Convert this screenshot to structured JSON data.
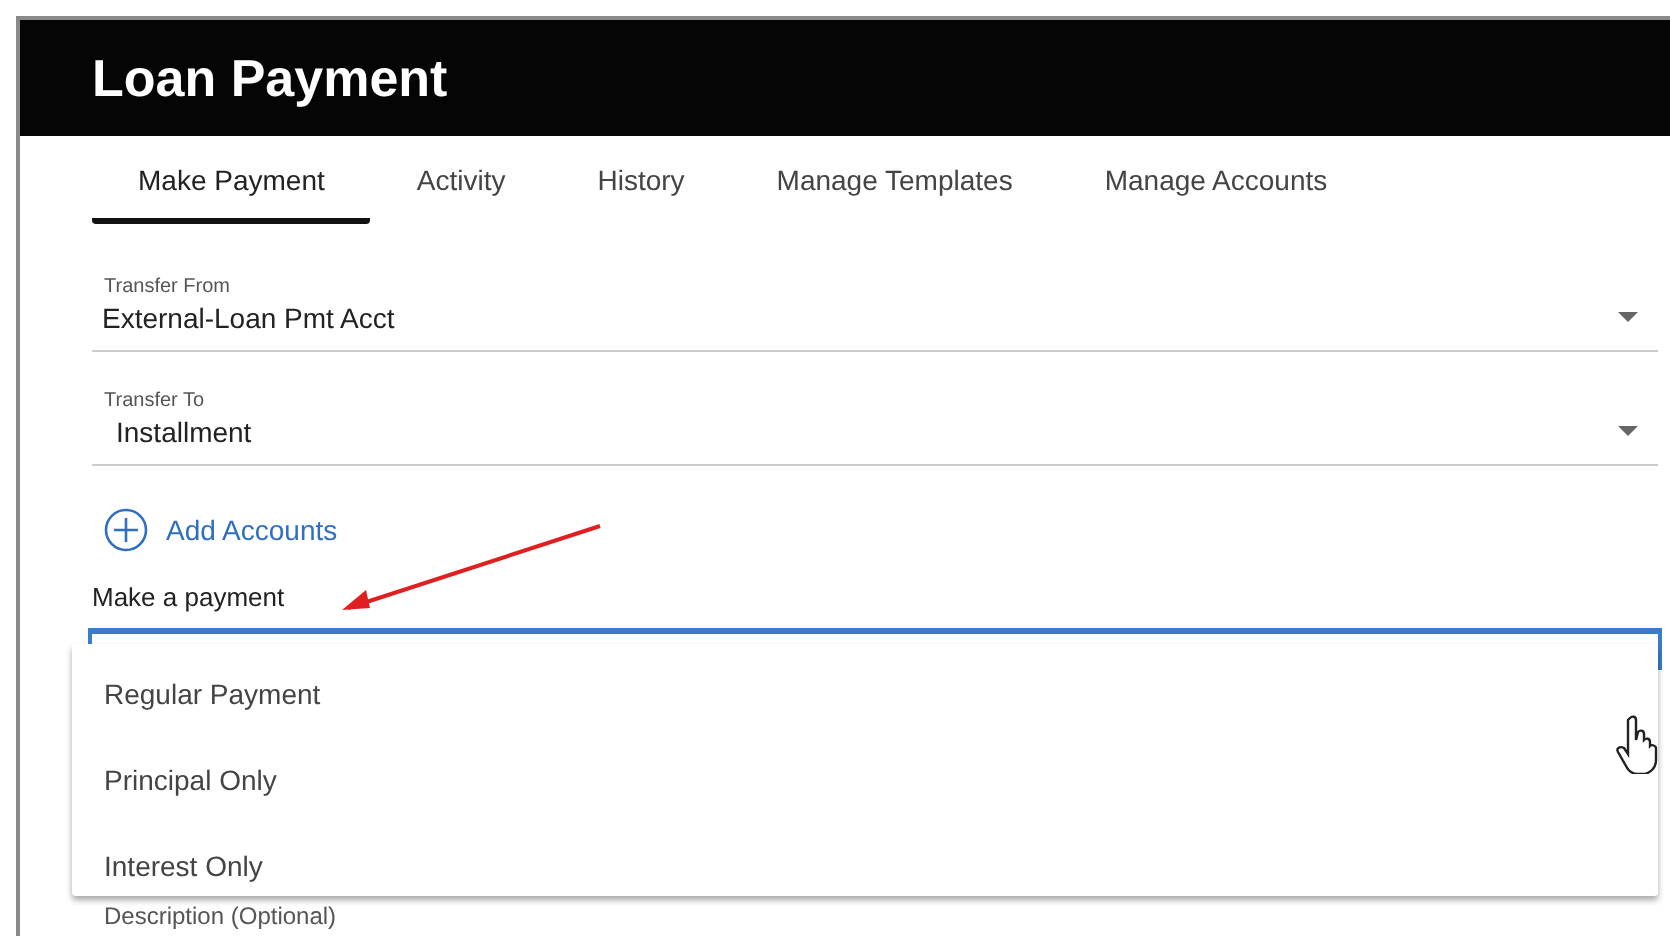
{
  "header": {
    "title": "Loan Payment"
  },
  "tabs": [
    {
      "label": "Make Payment",
      "selected": true
    },
    {
      "label": "Activity",
      "selected": false
    },
    {
      "label": "History",
      "selected": false
    },
    {
      "label": "Manage Templates",
      "selected": false
    },
    {
      "label": "Manage Accounts",
      "selected": false
    }
  ],
  "fields": [
    {
      "label": "Transfer From",
      "value": "External-Loan Pmt Acct"
    },
    {
      "label": "Transfer To",
      "value": "Installment"
    }
  ],
  "add_accounts": {
    "label": "Add Accounts"
  },
  "payment_select": {
    "label": "Make a payment",
    "expanded": true,
    "options": [
      {
        "label": "Regular Payment",
        "selected": false
      },
      {
        "label": "Principal Only",
        "selected": false
      },
      {
        "label": "Interest Only",
        "selected": false
      }
    ]
  },
  "description_field": {
    "label": "Description (Optional)"
  }
}
